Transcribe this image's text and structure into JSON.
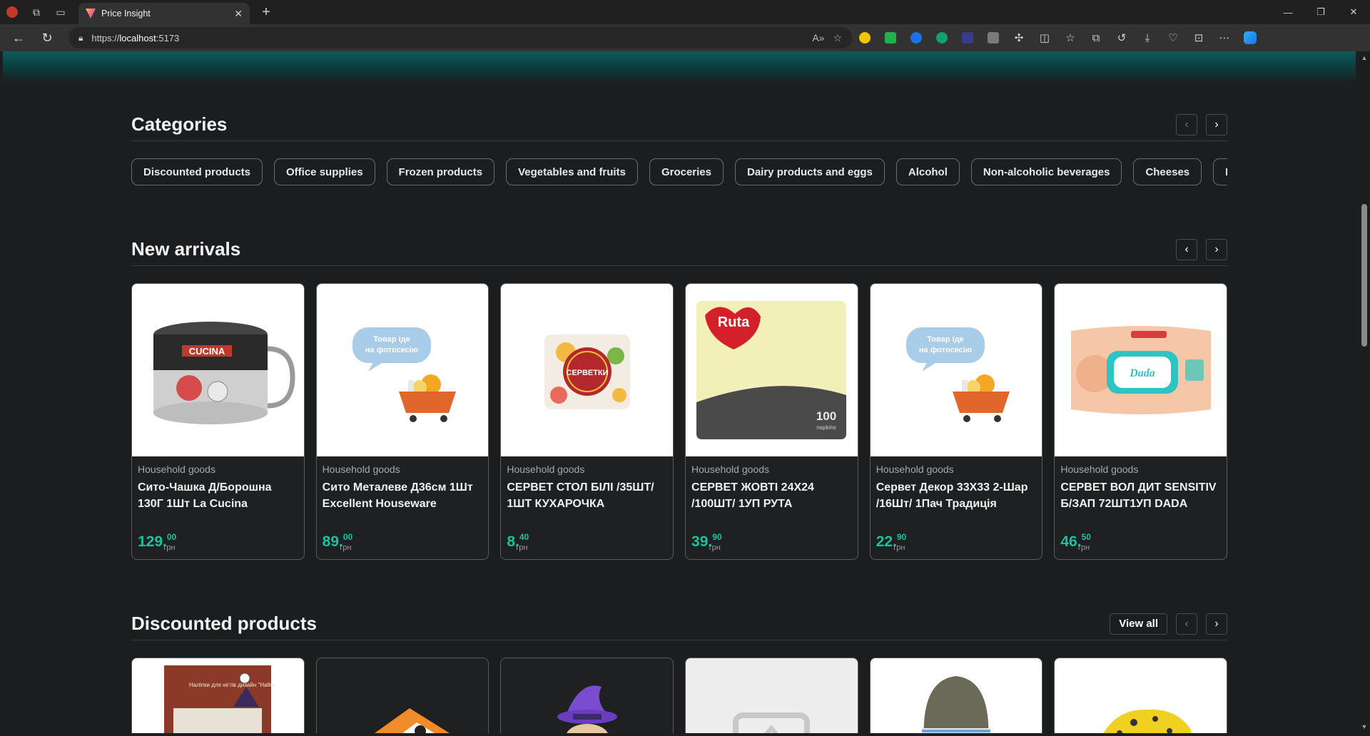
{
  "browser": {
    "tab_title": "Price Insight",
    "url_prefix": "https://",
    "url_host": "localhost",
    "url_port": ":5173",
    "extensions": [
      "#f5c400",
      "#22b14c",
      "#1a73e8",
      "#12a06b",
      "#3a3a8c",
      "#7a7a7a"
    ]
  },
  "categories": {
    "title": "Categories",
    "items": [
      "Discounted products",
      "Office supplies",
      "Frozen products",
      "Vegetables and fruits",
      "Groceries",
      "Dairy products and eggs",
      "Alcohol",
      "Non-alcoholic beverages",
      "Cheeses",
      "Me"
    ]
  },
  "new_arrivals": {
    "title": "New arrivals",
    "currency": "грн",
    "products": [
      {
        "category": "Household goods",
        "name": "Сито-Чашка Д/Борошна 130Г 1Шт La Cucina",
        "price_int": "129.",
        "price_dec": "00",
        "image": "sieve-cup"
      },
      {
        "category": "Household goods",
        "name": "Сито Металеве Д36см 1Шт Excellent Houseware",
        "price_int": "89.",
        "price_dec": "00",
        "image": "placeholder-cart"
      },
      {
        "category": "Household goods",
        "name": "СЕРВЕТ СТОЛ БІЛІ /35ШТ/ 1ШТ КУХАРОЧКА",
        "price_int": "8.",
        "price_dec": "40",
        "image": "napkins-pack"
      },
      {
        "category": "Household goods",
        "name": "СЕРВЕТ ЖОВТІ 24Х24 /100ШТ/ 1УП РУТА",
        "price_int": "39.",
        "price_dec": "90",
        "image": "ruta-napkins"
      },
      {
        "category": "Household goods",
        "name": "Сервет Декор 33Х33 2-Шар /16Шт/ 1Пач Традиція",
        "price_int": "22.",
        "price_dec": "90",
        "image": "placeholder-cart"
      },
      {
        "category": "Household goods",
        "name": "СЕРВЕТ ВОЛ ДИТ SENSITIV Б/ЗАП 72ШТ1УП DADA",
        "price_int": "46.",
        "price_dec": "50",
        "image": "wet-wipes"
      }
    ],
    "placeholder_text_1": "Товар іде",
    "placeholder_text_2": "на фотосесію",
    "ruta_brand": "Ruta",
    "ruta_count": "100",
    "ruta_unit": "napkins",
    "napkin_label": "СЕРВЕТКИ",
    "cucina_label": "CUCINA",
    "dada_label": "Dada"
  },
  "discounted": {
    "title": "Discounted products",
    "view_all": "View all",
    "halloween_text": "Наліпки для нігтів дизайн \"Halloween\""
  }
}
